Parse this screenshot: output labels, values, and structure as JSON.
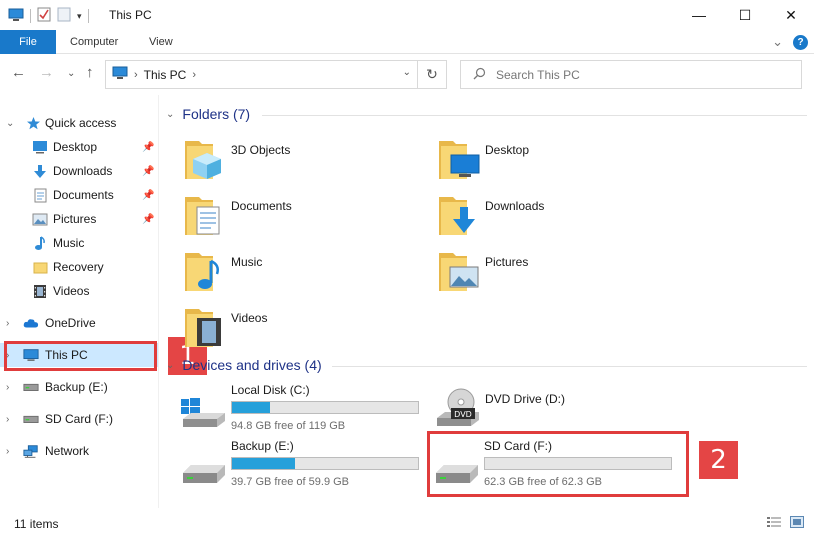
{
  "window": {
    "title": "This PC",
    "minimize": "—",
    "maximize": "☐",
    "close": "✕"
  },
  "ribbon": {
    "tabs": [
      "File",
      "Computer",
      "View"
    ],
    "collapse": "⌄",
    "help": "?"
  },
  "navigation": {
    "back": "←",
    "forward": "→",
    "recent": "⌄",
    "up": "↑",
    "address_crumb": "This PC",
    "refresh": "↻",
    "search_placeholder": "Search This PC"
  },
  "sidebar": {
    "quick_access": "Quick access",
    "items": [
      {
        "label": "Desktop",
        "icon": "desktop-icon",
        "pinned": true
      },
      {
        "label": "Downloads",
        "icon": "download-arrow-icon",
        "pinned": true
      },
      {
        "label": "Documents",
        "icon": "document-icon",
        "pinned": true
      },
      {
        "label": "Pictures",
        "icon": "picture-icon",
        "pinned": true
      },
      {
        "label": "Music",
        "icon": "music-note-icon",
        "pinned": false
      },
      {
        "label": "Recovery",
        "icon": "folder-icon",
        "pinned": false
      },
      {
        "label": "Videos",
        "icon": "film-icon",
        "pinned": false
      }
    ],
    "onedrive": "OneDrive",
    "this_pc": "This PC",
    "backup": "Backup (E:)",
    "sd_card": "SD Card (F:)",
    "network": "Network"
  },
  "main": {
    "folders_header": "Folders (7)",
    "folders": [
      {
        "name": "3D Objects",
        "icon": "3d-objects-folder-icon"
      },
      {
        "name": "Desktop",
        "icon": "desktop-folder-icon"
      },
      {
        "name": "Documents",
        "icon": "documents-folder-icon"
      },
      {
        "name": "Downloads",
        "icon": "downloads-folder-icon"
      },
      {
        "name": "Music",
        "icon": "music-folder-icon"
      },
      {
        "name": "Pictures",
        "icon": "pictures-folder-icon"
      },
      {
        "name": "Videos",
        "icon": "videos-folder-icon"
      }
    ],
    "devices_header": "Devices and drives (4)",
    "drives": [
      {
        "name": "Local Disk (C:)",
        "free": "94.8 GB free of 119 GB",
        "used_fraction": 0.203,
        "icon": "windows-drive-icon"
      },
      {
        "name": "DVD Drive (D:)",
        "free": "",
        "used_fraction": null,
        "icon": "dvd-drive-icon"
      },
      {
        "name": "Backup (E:)",
        "free": "39.7 GB free of 59.9 GB",
        "used_fraction": 0.337,
        "icon": "hard-drive-icon"
      },
      {
        "name": "SD Card (F:)",
        "free": "62.3 GB free of 62.3 GB",
        "used_fraction": 0.0,
        "icon": "hard-drive-icon"
      }
    ]
  },
  "callouts": {
    "one": "1",
    "two": "2"
  },
  "status": {
    "items": "11 items"
  },
  "colors": {
    "accent": "#1979ca",
    "selection": "#cce8ff",
    "callout": "#e03c3c",
    "drive_fill": "#26a0da",
    "folder_yellow": "#f8d775"
  }
}
